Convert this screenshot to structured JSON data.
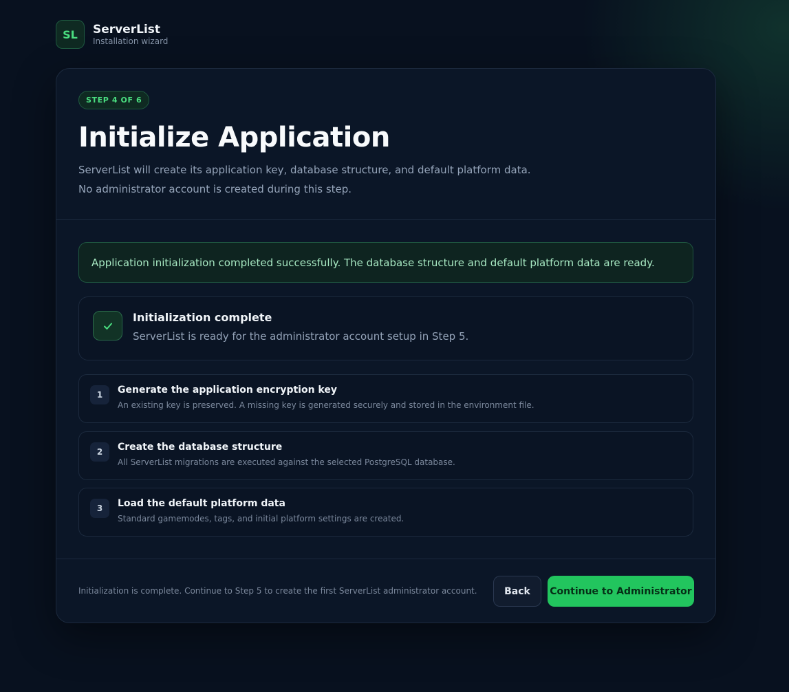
{
  "brand": {
    "logo_text": "SL",
    "name": "ServerList",
    "subtitle": "Installation wizard"
  },
  "header": {
    "step_badge": "STEP 4 OF 6",
    "title": "Initialize Application",
    "description": "ServerList will create its application key, database structure, and default platform data. No administrator account is created during this step."
  },
  "alert": {
    "text": "Application initialization completed successfully. The database structure and default platform data are ready."
  },
  "status": {
    "icon": "check-icon",
    "title": "Initialization complete",
    "text": "ServerList is ready for the administrator account setup in Step 5."
  },
  "steps": [
    {
      "number": "1",
      "title": "Generate the application encryption key",
      "description": "An existing key is preserved. A missing key is generated securely and stored in the environment file."
    },
    {
      "number": "2",
      "title": "Create the database structure",
      "description": "All ServerList migrations are executed against the selected PostgreSQL database."
    },
    {
      "number": "3",
      "title": "Load the default platform data",
      "description": "Standard gamemodes, tags, and initial platform settings are created."
    }
  ],
  "footer": {
    "note": "Initialization is complete. Continue to Step 5 to create the first ServerList administrator account.",
    "back_label": "Back",
    "continue_label": "Continue to Administrator"
  },
  "colors": {
    "background": "#08111f",
    "card": "#0b1627",
    "accent": "#22c55e",
    "success_text": "#a7e8c2"
  }
}
